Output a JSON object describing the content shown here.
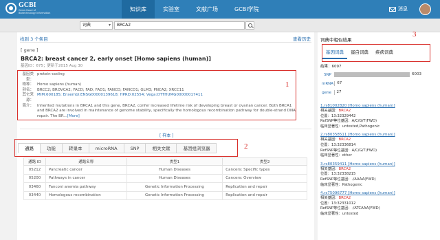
{
  "app": {
    "logo_main": "GCBI",
    "logo_sub1": "Gene-Cloud of",
    "logo_sub2": "Biotechnology Information",
    "nav": [
      "知识库",
      "实验室",
      "文献广场",
      "GCBI学院"
    ],
    "messages": "消息"
  },
  "search": {
    "scope": "词典",
    "query": "BRCA2"
  },
  "results": {
    "found": "找到 3 个条目",
    "history": "查看历史"
  },
  "gene": {
    "tag": "[ gene ]",
    "title": "BRCA2: breast cancer 2, early onset [Homo sapiens (human)]",
    "meta": "基因ID：675；更新于2015 Aug 30",
    "fields": [
      {
        "label": "基因类型：",
        "value": "protein-coding",
        "link": false
      },
      {
        "label": "物种：",
        "value": "Homo sapiens (human)",
        "link": false
      },
      {
        "label": "别名：",
        "value": "BRCC2; BROVCA2; FACD; FAD; FAD1; FANCD; FANCD1; GLM3; PNCA2; XRCC11",
        "link": false
      },
      {
        "label": "其它来源：",
        "value": "MIM:600185;    Ensembl:ENSG00000139618;    HPRD:02554;    Vega:OTTHUMG00000017411",
        "link": true
      }
    ],
    "summary_label": "简介：",
    "summary": "Inherited mutations in BRCA1 and this gene, BRCA2, confer increased lifetime risk of developing breast or ovarian cancer. Both BRCA1 and BRCA2 are involved in maintenance of genome stability, specifically the homologous recombination pathway for double-strand DNA repair. The BR...",
    "more": "[More]"
  },
  "sample_link": "[ 样本 ]",
  "tabs": [
    "通路",
    "功能",
    "转录本",
    "microRNA",
    "SNP",
    "相关文献",
    "基因组浏览器"
  ],
  "pathway_table": {
    "headers": [
      "通路 ID",
      "通路名称",
      "类型1",
      "类型2"
    ],
    "rows": [
      [
        "05212",
        "Pancreatic cancer",
        "Human Diseases",
        "Cancers: Specific types"
      ],
      [
        "05200",
        "Pathways in cancer",
        "Human Diseases",
        "Cancers: Overview"
      ],
      [
        "03460",
        "Fanconi anemia pathway",
        "Genetic Information Processing",
        "Replication and repair"
      ],
      [
        "03440",
        "Homologous recombination",
        "Genetic Information Processing",
        "Replication and repair"
      ]
    ]
  },
  "callouts": [
    "1",
    "2",
    "3"
  ],
  "side": {
    "title": "词典中相似结果",
    "tabs": [
      "基因词典",
      "蛋白词典",
      "疾病词典"
    ],
    "total": "结果：6097",
    "bars": [
      {
        "label": "SNP",
        "value": 6003
      },
      {
        "label": "mRNA",
        "value": 67
      },
      {
        "label": "gene",
        "value": 27
      }
    ],
    "items": [
      {
        "title": "1.rs81002820 [Homo sapiens (human)]",
        "gene_label": "相关基因：",
        "gene": "BRCA2",
        "pos": "位置：13:32329442",
        "allele": "RefSNP等位基因：A/C/G/T(FWD)",
        "sig": "临床显著性：untested,Pathogenic"
      },
      {
        "title": "2.rs80358511 [Homo sapiens (human)]",
        "gene_label": "相关基因：",
        "gene": "BRCA2",
        "pos": "位置：13:32336814",
        "allele": "RefSNP等位基因：A/C/G/T(FWD)",
        "sig": "临床显著性：other"
      },
      {
        "title": "3.rs80359411 [Homo sapiens (human)]",
        "gene_label": "相关基因：",
        "gene": "BRCA2",
        "pos": "位置：13:32338215",
        "allele": "RefSNP等位基因：-/AAAA(FWD)",
        "sig": "临床显著性：Pathogenic"
      },
      {
        "title": "4.rs75096777 [Homo sapiens (human)]",
        "gene_label": "相关基因：",
        "gene": "BRCA2",
        "pos": "位置：13:32331012",
        "allele": "RefSNP等位基因：-/ATCAAA(FWD)",
        "sig": "临床显著性：untested"
      }
    ]
  },
  "colors": {
    "header": "#2f7fb8",
    "highlight": "#d9302c",
    "link": "#2a6fb0"
  }
}
